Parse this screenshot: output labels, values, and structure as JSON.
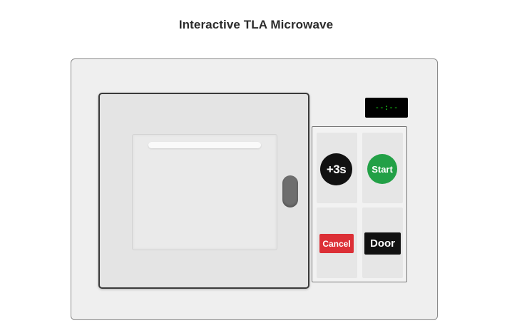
{
  "page": {
    "title": "Interactive TLA Microwave"
  },
  "microwave": {
    "display_text": "--:--",
    "display_color": "#19e019",
    "buttons": {
      "plus3": {
        "label": "+3s",
        "color": "#111111"
      },
      "start": {
        "label": "Start",
        "color": "#22a046"
      },
      "cancel": {
        "label": "Cancel",
        "color": "#dc2f36"
      },
      "door": {
        "label": "Door",
        "color": "#111111"
      }
    }
  }
}
